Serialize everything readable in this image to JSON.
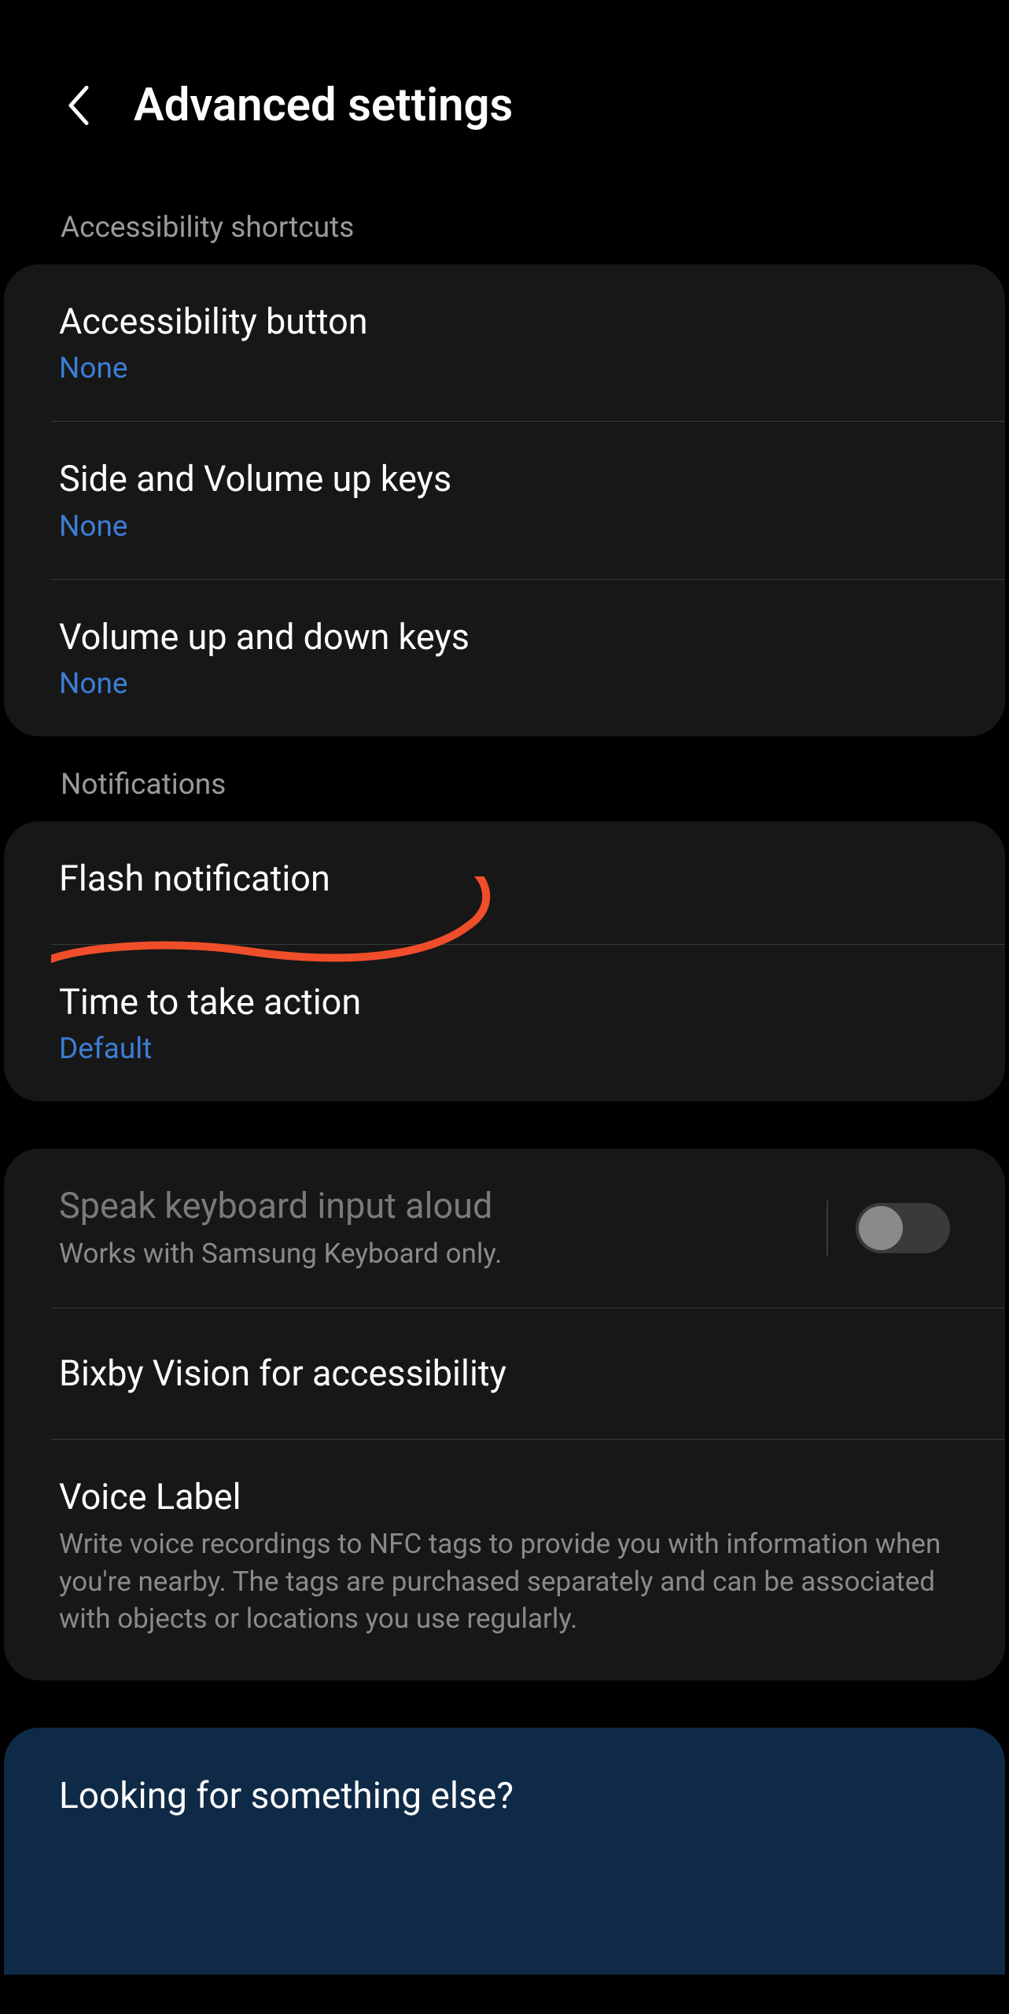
{
  "header": {
    "title": "Advanced settings"
  },
  "sections": {
    "shortcuts": {
      "header": "Accessibility shortcuts",
      "accessibility_button": {
        "title": "Accessibility button",
        "value": "None"
      },
      "side_volume": {
        "title": "Side and Volume up keys",
        "value": "None"
      },
      "volume_updown": {
        "title": "Volume up and down keys",
        "value": "None"
      }
    },
    "notifications": {
      "header": "Notifications",
      "flash": {
        "title": "Flash notification"
      },
      "time_action": {
        "title": "Time to take action",
        "value": "Default"
      }
    },
    "other": {
      "speak_keyboard": {
        "title": "Speak keyboard input aloud",
        "description": "Works with Samsung Keyboard only."
      },
      "bixby_vision": {
        "title": "Bixby Vision for accessibility"
      },
      "voice_label": {
        "title": "Voice Label",
        "description": "Write voice recordings to NFC tags to provide you with information when you're nearby. The tags are purchased separately and can be associated with objects or locations you use regularly."
      }
    }
  },
  "footer": {
    "title": "Looking for something else?"
  }
}
